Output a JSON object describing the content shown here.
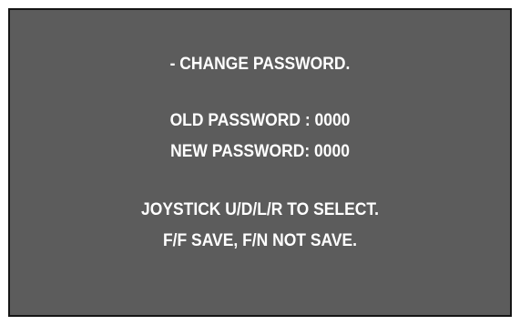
{
  "menu": {
    "title": "- CHANGE PASSWORD.",
    "old_password": "OLD PASSWORD : 0000",
    "new_password": "NEW PASSWORD: 0000",
    "instruction_select": "JOYSTICK U/D/L/R TO SELECT.",
    "instruction_save": "F/F SAVE, F/N NOT SAVE."
  },
  "colors": {
    "background": "#5c5c5c",
    "text": "#ffffff",
    "border": "#151515"
  }
}
